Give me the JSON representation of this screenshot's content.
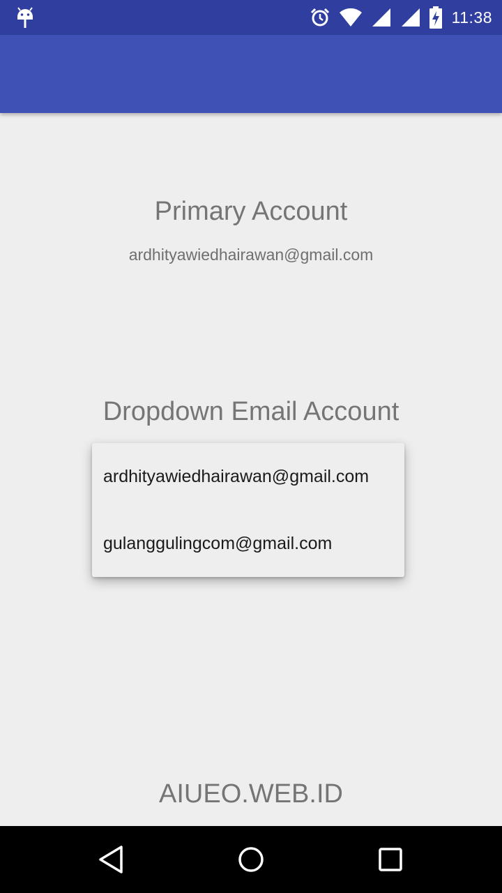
{
  "status_bar": {
    "time": "11:38",
    "icons": [
      "android-debug-icon",
      "alarm-icon",
      "wifi-icon",
      "signal-icon",
      "signal-icon",
      "battery-charging-icon"
    ]
  },
  "app_bar": {
    "color": "#3f51b5"
  },
  "primary_section": {
    "title": "Primary Account",
    "email": "ardhityawiedhairawan@gmail.com"
  },
  "dropdown_section": {
    "title": "Dropdown Email Account",
    "options": [
      "ardhityawiedhairawan@gmail.com",
      "gulanggulingcom@gmail.com"
    ]
  },
  "footer": {
    "text": "AIUEO.WEB.ID"
  },
  "nav_bar": {
    "icons": [
      "back-icon",
      "home-icon",
      "recents-icon"
    ]
  },
  "colors": {
    "status_bar": "#303f9f",
    "primary": "#3f51b5",
    "background": "#eeeeee",
    "text_secondary": "#757575"
  }
}
